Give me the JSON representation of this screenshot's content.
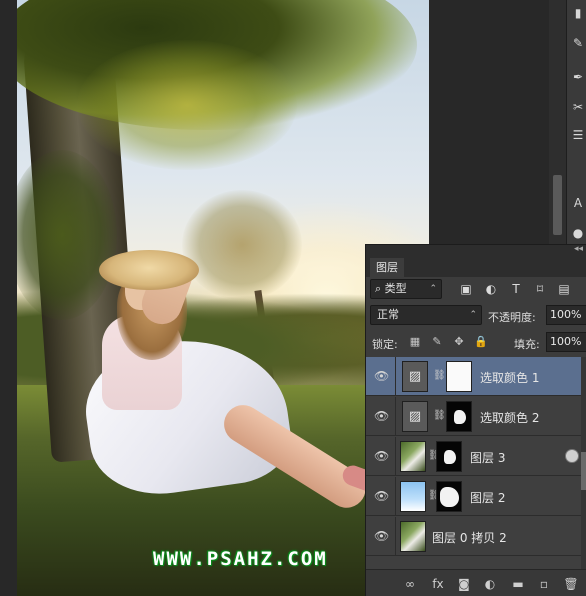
{
  "watermark": "WWW.PSAHZ.COM",
  "tool_strip": {
    "icons": [
      "stamp-tool-icon",
      "brush-tool-icon",
      "tool-icon",
      "tool-icon",
      "tool-icon",
      "text-tool-icon",
      "tool-icon"
    ],
    "tools": [
      "▮",
      "✎",
      "✒",
      "✂",
      "☰",
      "A",
      "●"
    ]
  },
  "panel": {
    "tab_label": "图层",
    "filter": {
      "type_label": "类型",
      "chevron": "⌃",
      "icons": [
        "▣",
        "◐",
        "T",
        "⌑",
        "▤"
      ]
    },
    "blend_mode": "正常",
    "opacity_label": "不透明度:",
    "opacity_value": "100%",
    "lock_label": "锁定:",
    "lock_icons": [
      "▦",
      "✎",
      "✥",
      "🔒"
    ],
    "fill_label": "填充:",
    "fill_value": "100%",
    "layers": [
      {
        "name": "选取颜色 1",
        "kind": "adjustment",
        "mask": "white",
        "selected": true
      },
      {
        "name": "选取颜色 2",
        "kind": "adjustment",
        "mask": "black-shape",
        "selected": false
      },
      {
        "name": "图层 3",
        "kind": "photo",
        "mask": "black-shape",
        "selected": false,
        "fx": true
      },
      {
        "name": "图层 2",
        "kind": "sky",
        "mask": "black-big-shape",
        "selected": false
      },
      {
        "name": "图层 0 拷贝 2",
        "kind": "photo",
        "mask": "none",
        "selected": false
      }
    ],
    "bottom_icons": [
      "∞",
      "fx",
      "◙",
      "◐",
      "▬",
      "▫",
      "🗑"
    ]
  },
  "colors": {
    "selection": "#5b6f8f",
    "panel_bg": "#3c3c3c",
    "watermark_outline": "#0b8a1c"
  }
}
